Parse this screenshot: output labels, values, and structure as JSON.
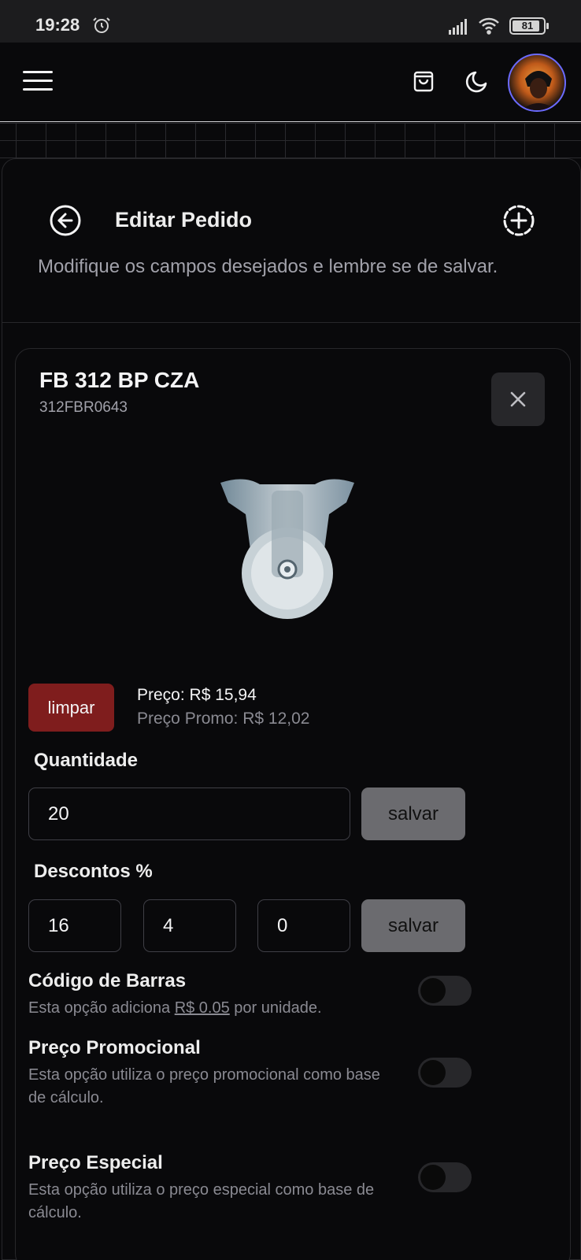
{
  "status_bar": {
    "time": "19:28",
    "battery": "81"
  },
  "header": {
    "menu_icon": "hamburger-icon",
    "cart_icon": "shopping-bag-icon",
    "theme_icon": "moon-icon"
  },
  "page": {
    "title": "Editar Pedido",
    "subtitle": "Modifique os campos desejados e lembre se de salvar."
  },
  "product": {
    "name": "FB 312 BP CZA",
    "code": "312FBR0643",
    "clear_label": "limpar",
    "price_label": "Preço: R$ 15,94",
    "promo_price_label": "Preço Promo: R$ 12,02"
  },
  "quantity": {
    "label": "Quantidade",
    "value": "20",
    "save_label": "salvar"
  },
  "discounts": {
    "label": "Descontos %",
    "values": [
      "16",
      "4",
      "0"
    ],
    "save_label": "salvar"
  },
  "options": [
    {
      "title": "Código de Barras",
      "desc_prefix": "Esta opção adiciona ",
      "desc_highlight": "R$ 0.05",
      "desc_suffix": " por unidade.",
      "enabled": false
    },
    {
      "title": "Preço Promocional",
      "desc": "Esta opção utiliza o preço promocional como base de cálculo.",
      "enabled": false
    },
    {
      "title": "Preço Especial",
      "desc": "Esta opção utiliza o preço especial como base de cálculo.",
      "enabled": false
    }
  ],
  "colors": {
    "background": "#09090b",
    "danger": "#7f1d1d",
    "border": "#27272a",
    "muted_text": "#a1a1aa"
  }
}
